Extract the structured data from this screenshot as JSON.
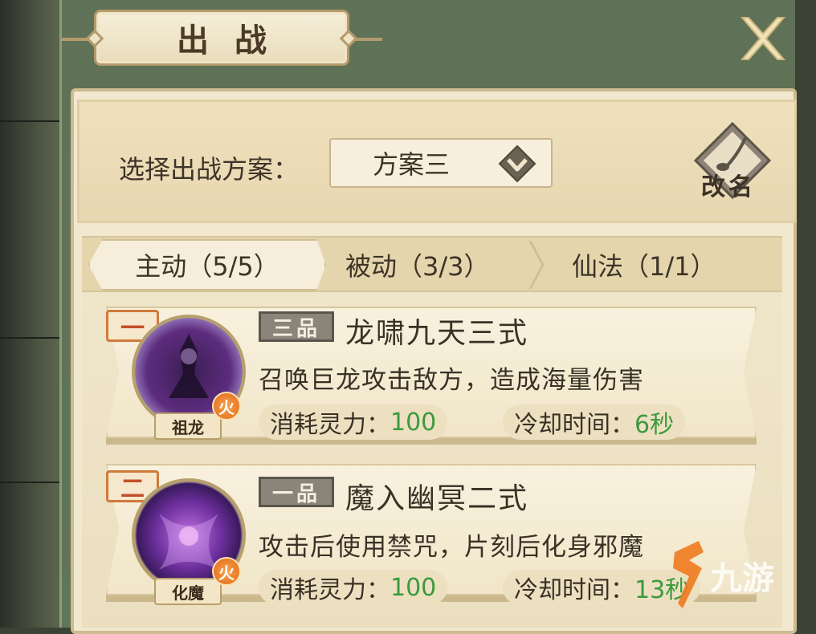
{
  "header": {
    "title": "出战"
  },
  "scheme": {
    "label": "选择出战方案：",
    "selected": "方案三",
    "rename_label": "改名"
  },
  "tabs": [
    {
      "label": "主动（5/5）",
      "active": true
    },
    {
      "label": "被动（3/3）",
      "active": false
    },
    {
      "label": "仙法（1/1）",
      "active": false
    }
  ],
  "skills": [
    {
      "rank": "一",
      "avatar_name": "祖龙",
      "element": "火",
      "grade": "三品",
      "name": "龙啸九天三式",
      "description": "召唤巨龙攻击敌方，造成海量伤害",
      "cost_label": "消耗灵力：",
      "cost_value": "100",
      "cooldown_label": "冷却时间：",
      "cooldown_value": "6秒"
    },
    {
      "rank": "二",
      "avatar_name": "化魔",
      "element": "火",
      "grade": "一品",
      "name": "魔入幽冥二式",
      "description": "攻击后使用禁咒，片刻后化身邪魔",
      "cost_label": "消耗灵力：",
      "cost_value": "100",
      "cooldown_label": "冷却时间：",
      "cooldown_value": "13秒"
    }
  ],
  "watermark": {
    "text": "九游"
  },
  "colors": {
    "accent_green": "#3c9a3c",
    "rank_orange": "#c1502a",
    "frame_green": "#617559"
  }
}
